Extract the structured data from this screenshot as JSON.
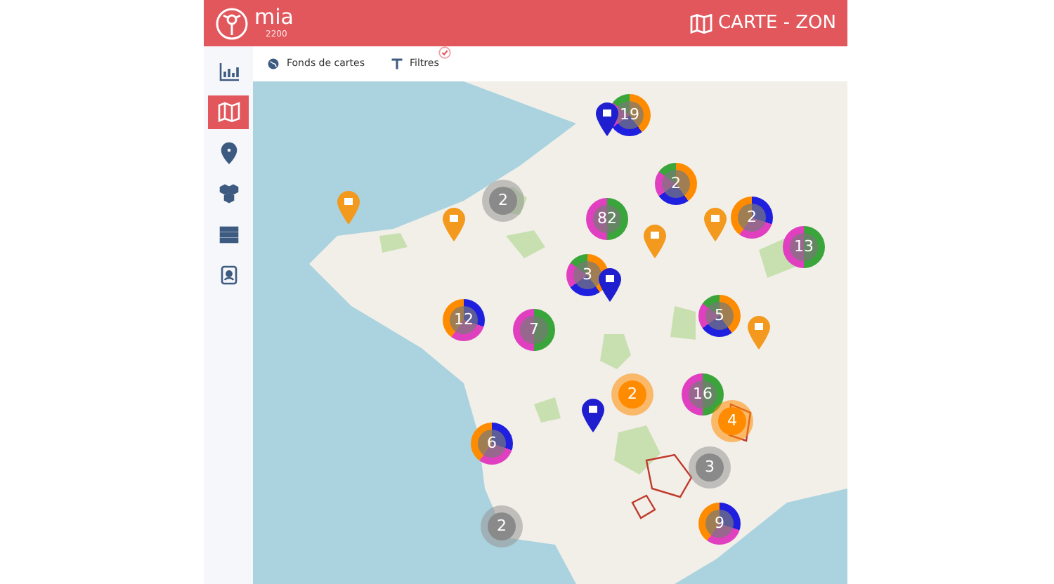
{
  "header": {
    "brand": "mia",
    "version": "2200",
    "title": "CARTE - ZON"
  },
  "sidebar": {
    "items": [
      {
        "selected": false
      },
      {
        "selected": true
      },
      {
        "selected": false
      },
      {
        "selected": false
      },
      {
        "selected": false
      },
      {
        "selected": false
      }
    ]
  },
  "toolbar": {
    "items": [
      {
        "label": "Fonds de cartes",
        "checked": false
      },
      {
        "label": "Filtres",
        "checked": true
      }
    ]
  },
  "map": {
    "clusters": [
      {
        "count": "19",
        "kind": "pie"
      },
      {
        "count": "2",
        "kind": "grey"
      },
      {
        "count": "82",
        "kind": "pie"
      },
      {
        "count": "2",
        "kind": "pie"
      },
      {
        "count": "2",
        "kind": "pie"
      },
      {
        "count": "13",
        "kind": "pie"
      },
      {
        "count": "3",
        "kind": "pie"
      },
      {
        "count": "12",
        "kind": "pie"
      },
      {
        "count": "7",
        "kind": "pie"
      },
      {
        "count": "5",
        "kind": "pie"
      },
      {
        "count": "2",
        "kind": "orange"
      },
      {
        "count": "16",
        "kind": "pie"
      },
      {
        "count": "4",
        "kind": "orange"
      },
      {
        "count": "6",
        "kind": "pie"
      },
      {
        "count": "3",
        "kind": "grey"
      },
      {
        "count": "2",
        "kind": "grey"
      },
      {
        "count": "9",
        "kind": "pie"
      }
    ],
    "pins": [
      {
        "kind": "orange"
      },
      {
        "kind": "orange"
      },
      {
        "kind": "orange"
      },
      {
        "kind": "orange"
      },
      {
        "kind": "orange"
      },
      {
        "kind": "blue"
      },
      {
        "kind": "blue"
      },
      {
        "kind": "blue"
      }
    ]
  }
}
